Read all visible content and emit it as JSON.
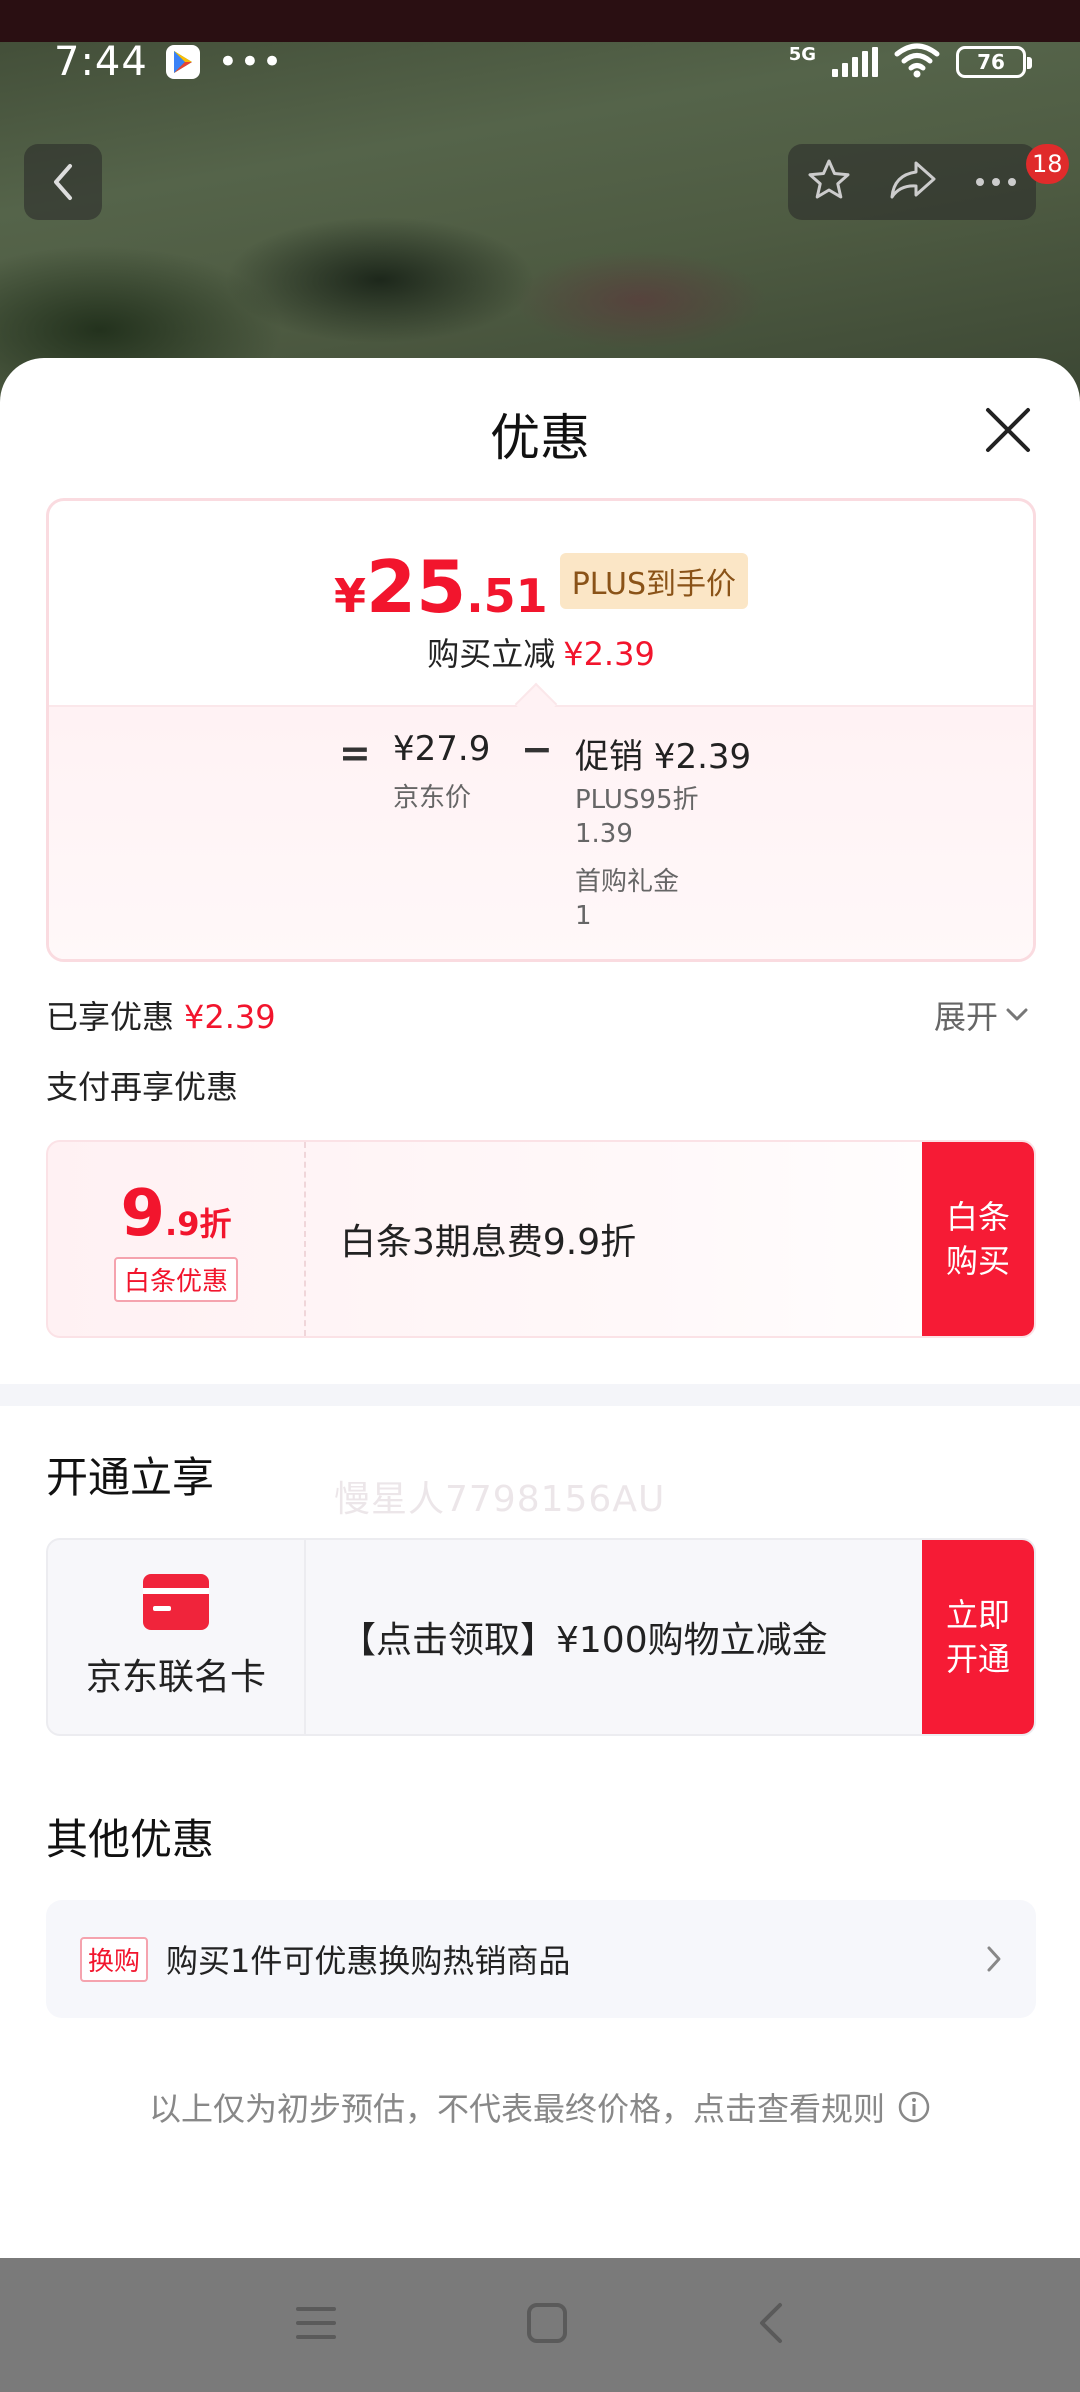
{
  "status_bar": {
    "time": "7:44",
    "network": "5G",
    "battery": "76"
  },
  "nav": {
    "badge_count": "18"
  },
  "sheet": {
    "title": "优惠",
    "price_card": {
      "currency": "¥",
      "final_price_int": "25",
      "final_price_dec": ".51",
      "plus_tag": "PLUS到手价",
      "reduce_label": "购买立减",
      "reduce_value": "¥2.39",
      "eq": "=",
      "jd_price": "¥27.9",
      "jd_price_label": "京东价",
      "minus": "−",
      "promo": "促销 ¥2.39",
      "promo_items": [
        {
          "name": "PLUS95折",
          "value": "1.39"
        },
        {
          "name": "首购礼金",
          "value": "1"
        }
      ]
    },
    "enjoyed_label": "已享优惠",
    "enjoyed_value": "¥2.39",
    "expand_label": "展开",
    "pay_again_label": "支付再享优惠",
    "watermark": "慢星人7798156AU",
    "baitiao": {
      "discount_big": "9",
      "discount_small": ".9折",
      "tag": "白条优惠",
      "text": "白条3期息费9.9折",
      "button": "白条购买"
    },
    "open_section_title": "开通立享",
    "card_offer": {
      "name": "京东联名卡",
      "text": "【点击领取】¥100购物立减金",
      "button": "立即开通"
    },
    "other_section_title": "其他优惠",
    "exchange": {
      "tag": "换购",
      "text": "购买1件可优惠换购热销商品"
    },
    "disclaimer": "以上仅为初步预估，不代表最终价格，点击查看规则"
  },
  "colors": {
    "accent_red": "#f2152d",
    "button_red": "#f61b35",
    "plus_gold": "#fbe6c6"
  }
}
